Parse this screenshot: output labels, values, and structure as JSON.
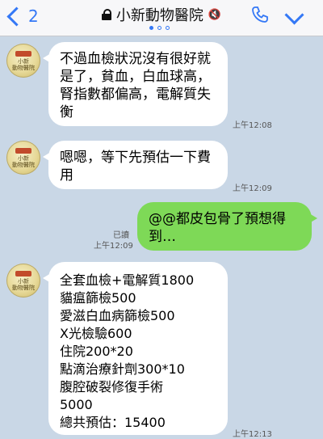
{
  "header": {
    "back_count": "2",
    "title": "小新動物醫院",
    "mute_icon": "🔇"
  },
  "avatar": {
    "name_line1": "小新",
    "name_line2": "動物醫院"
  },
  "messages": [
    {
      "text": "不過血檢狀況沒有很好就是了，貧血，白血球高，腎指數都偏高，電解質失衡",
      "time": "上午12:08"
    },
    {
      "text": "嗯嗯，等下先預估一下費用",
      "time": "上午12:09"
    },
    {
      "text": "@@都皮包骨了預想得到…",
      "read": "已讀",
      "time": "上午12:09"
    },
    {
      "lines": [
        "全套血檢+電解質1800",
        "貓瘟篩檢500",
        "愛滋白血病篩檢500",
        "X光檢驗600",
        "住院200*20",
        "點滴治療針劑300*10",
        "腹腔破裂修復手術",
        "5000",
        "總共預估：15400"
      ],
      "time": "上午12:13"
    }
  ]
}
